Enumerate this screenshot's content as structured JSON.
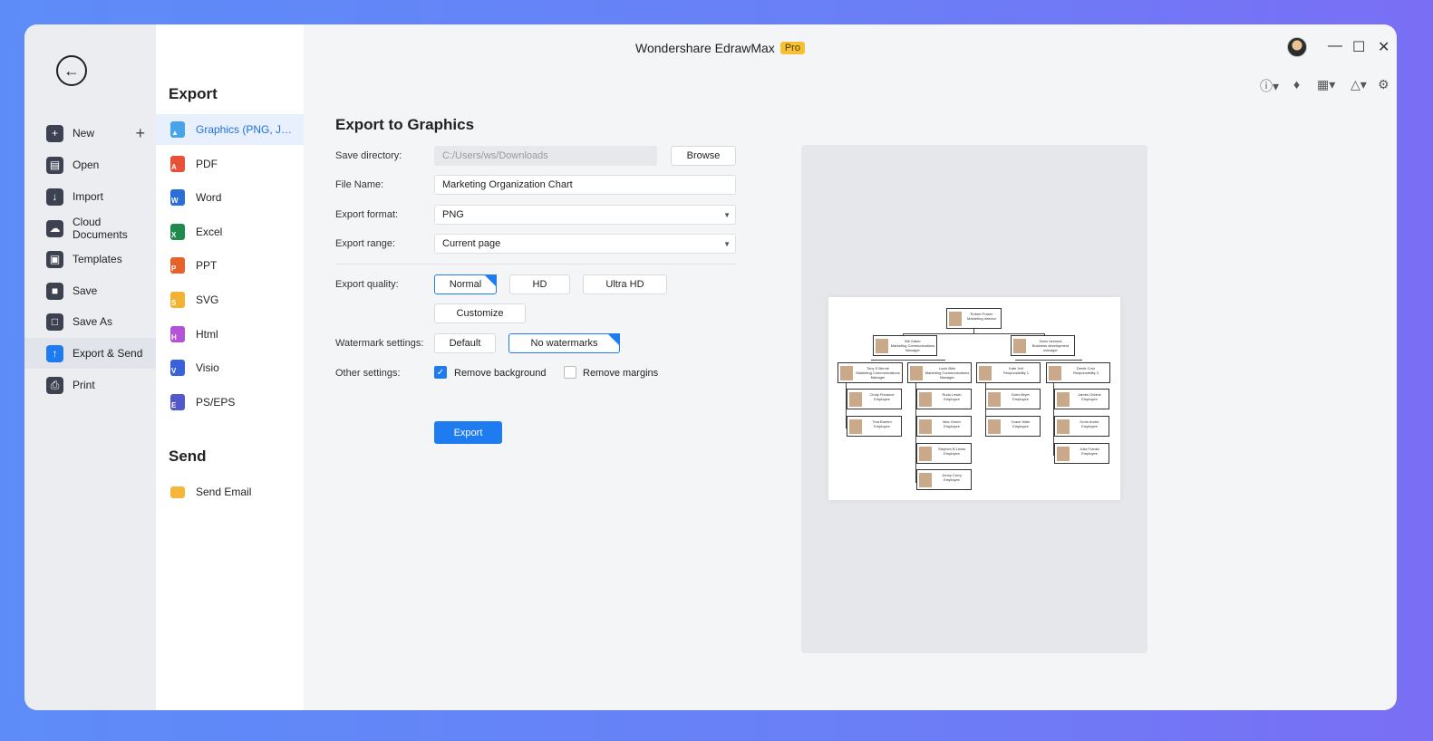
{
  "app": {
    "title": "Wondershare EdrawMax",
    "badge": "Pro",
    "window_controls": [
      "minimize-icon",
      "maximize-icon",
      "close-icon"
    ],
    "accent_color": "#1f7cf0"
  },
  "nav": {
    "items": [
      {
        "label": "New",
        "icon": "plus-square-icon"
      },
      {
        "label": "Open",
        "icon": "folder-icon"
      },
      {
        "label": "Import",
        "icon": "import-icon"
      },
      {
        "label": "Cloud Documents",
        "icon": "cloud-icon"
      },
      {
        "label": "Templates",
        "icon": "templates-icon"
      },
      {
        "label": "Save",
        "icon": "save-icon"
      },
      {
        "label": "Save As",
        "icon": "save-as-icon"
      },
      {
        "label": "Export & Send",
        "icon": "export-icon",
        "active": true
      },
      {
        "label": "Print",
        "icon": "print-icon"
      }
    ]
  },
  "export_panel": {
    "title": "Export",
    "formats": [
      {
        "label": "Graphics (PNG, JPG et...",
        "color": "#4aa3e8",
        "active": true
      },
      {
        "label": "PDF",
        "color": "#e8503a"
      },
      {
        "label": "Word",
        "color": "#2b6fd6"
      },
      {
        "label": "Excel",
        "color": "#1e8a4c"
      },
      {
        "label": "PPT",
        "color": "#e5622a"
      },
      {
        "label": "SVG",
        "color": "#f2b233"
      },
      {
        "label": "Html",
        "color": "#b452d6"
      },
      {
        "label": "Visio",
        "color": "#3a62d8"
      },
      {
        "label": "PS/EPS",
        "color": "#5257c9"
      }
    ],
    "send_title": "Send",
    "send_items": [
      {
        "label": "Send Email",
        "color": "#f4b63b"
      }
    ]
  },
  "form": {
    "title": "Export to Graphics",
    "save_directory_label": "Save directory:",
    "save_directory_value": "C:/Users/ws/Downloads",
    "browse_label": "Browse",
    "file_name_label": "File Name:",
    "file_name_value": "Marketing Organization Chart",
    "export_format_label": "Export format:",
    "export_format_value": "PNG",
    "export_range_label": "Export range:",
    "export_range_value": "Current page",
    "export_quality_label": "Export quality:",
    "quality_options": [
      "Normal",
      "HD",
      "Ultra HD"
    ],
    "quality_selected": "Normal",
    "customize_label": "Customize",
    "watermark_label": "Watermark settings:",
    "watermark_options": [
      "Default",
      "No watermarks"
    ],
    "watermark_selected": "No watermarks",
    "other_settings_label": "Other settings:",
    "remove_background_label": "Remove background",
    "remove_background_checked": true,
    "remove_margins_label": "Remove margins",
    "remove_margins_checked": false,
    "export_button_label": "Export"
  },
  "preview": {
    "nodes": [
      {
        "name": "Robert Fraser",
        "role": "Marketing director"
      },
      {
        "name": "Bill Gaber",
        "role": "Marketing Communications Manager"
      },
      {
        "name": "Dario Ishmeal",
        "role": "Business development manager"
      },
      {
        "name": "Tony S Bernie",
        "role": "Marketing Communications Manager"
      },
      {
        "name": "Louis Biler",
        "role": "Marketing Communications Manager"
      },
      {
        "name": "Kate Jett",
        "role": "Responsibility 1"
      },
      {
        "name": "Derek Cruz",
        "role": "Responsibility 2"
      },
      {
        "name": "Cindy Florance",
        "role": "Employee"
      },
      {
        "name": "Tina Boehm",
        "role": "Employee"
      },
      {
        "name": "Rudo Lewin",
        "role": "Employee"
      },
      {
        "name": "Max Green",
        "role": "Employee"
      },
      {
        "name": "Stephen B Lewis",
        "role": "Employee"
      },
      {
        "name": "Jenny Curry",
        "role": "Employee"
      },
      {
        "name": "Doris Bryer",
        "role": "Employee"
      },
      {
        "name": "Grace Wale",
        "role": "Employee"
      },
      {
        "name": "James Ochine",
        "role": "Employee"
      },
      {
        "name": "Doris Andre",
        "role": "Employee"
      },
      {
        "name": "Julia Franks",
        "role": "Employee"
      }
    ]
  }
}
